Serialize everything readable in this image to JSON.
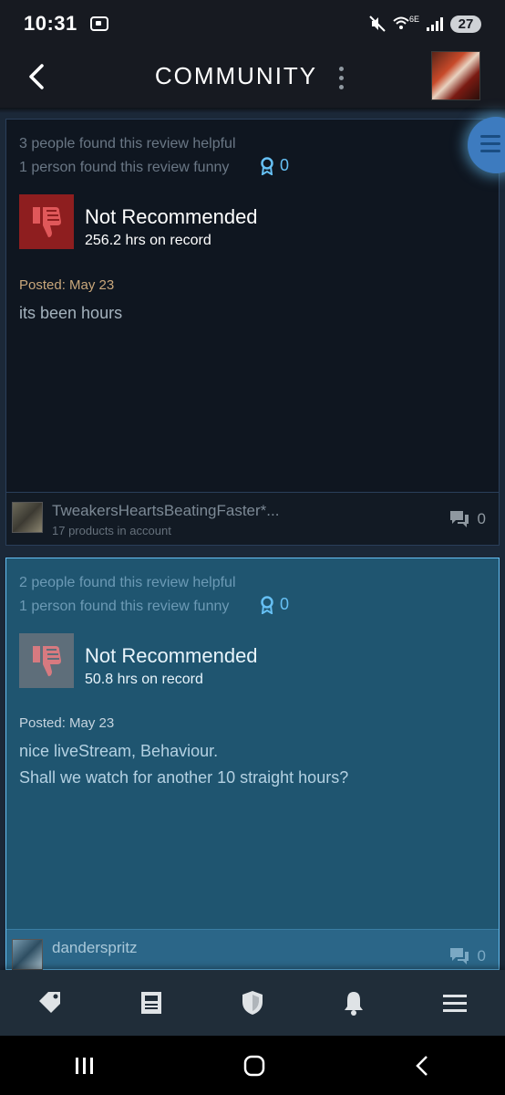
{
  "status_bar": {
    "time": "10:31",
    "network": "6E",
    "battery": "27"
  },
  "header": {
    "title": "COMMUNITY"
  },
  "reviews": [
    {
      "helpful": "3 people found this review helpful",
      "funny": "1 person found this review funny",
      "awards": "0",
      "verdict": "Not Recommended",
      "hours": "256.2 hrs on record",
      "posted": "Posted: May 23",
      "body": [
        "its been hours"
      ],
      "username": "TweakersHeartsBeatingFaster*...",
      "products": "17 products in account",
      "comments": "0"
    },
    {
      "helpful": "2 people found this review helpful",
      "funny": "1 person found this review funny",
      "awards": "0",
      "verdict": "Not Recommended",
      "hours": "50.8 hrs on record",
      "posted": "Posted: May 23",
      "body": [
        "nice liveStream, Behaviour.",
        "Shall we watch for another 10 straight hours?"
      ],
      "username": "danderspritz",
      "comments": "0"
    }
  ],
  "tab_bar": [
    "tag-icon",
    "news-icon",
    "shield-icon",
    "bell-icon",
    "menu-icon"
  ],
  "colors": {
    "accent": "#66c0f4",
    "not_recommended": "#8e1e1f",
    "background": "#1b2838"
  }
}
